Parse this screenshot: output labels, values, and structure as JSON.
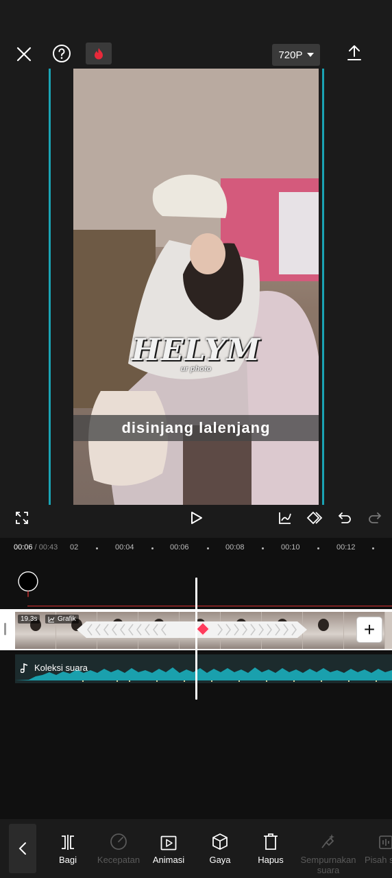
{
  "header": {
    "resolution": "720P"
  },
  "preview": {
    "logo_text": "HELYM",
    "logo_sub": "ur photo",
    "caption": "disinjang lalenjang"
  },
  "timeline": {
    "current_time": "00:06",
    "total_time": "/ 00:43",
    "ticks": [
      "02",
      "00:04",
      "00:06",
      "00:08",
      "00:10",
      "00:12"
    ],
    "clip_duration": "19.3s",
    "clip_graph_label": "Grafik",
    "audio_label": "Koleksi suara"
  },
  "toolbar": {
    "items": [
      {
        "label": "Bagi",
        "icon": "split-icon",
        "enabled": true
      },
      {
        "label": "Kecepatan",
        "icon": "speed-icon",
        "enabled": false
      },
      {
        "label": "Animasi",
        "icon": "animation-icon",
        "enabled": true
      },
      {
        "label": "Gaya",
        "icon": "style-cube-icon",
        "enabled": true
      },
      {
        "label": "Hapus",
        "icon": "delete-icon",
        "enabled": true
      },
      {
        "label": "Sempurnakan suara",
        "icon": "enhance-voice-icon",
        "enabled": false
      },
      {
        "label": "Pisah s",
        "icon": "separate-icon",
        "enabled": false
      }
    ]
  },
  "colors": {
    "accent_cyan": "#1aa3b4",
    "keyframe_red": "#ff3b5c",
    "flame_red": "#e8293a",
    "audio_wave": "#1aa0ad"
  }
}
